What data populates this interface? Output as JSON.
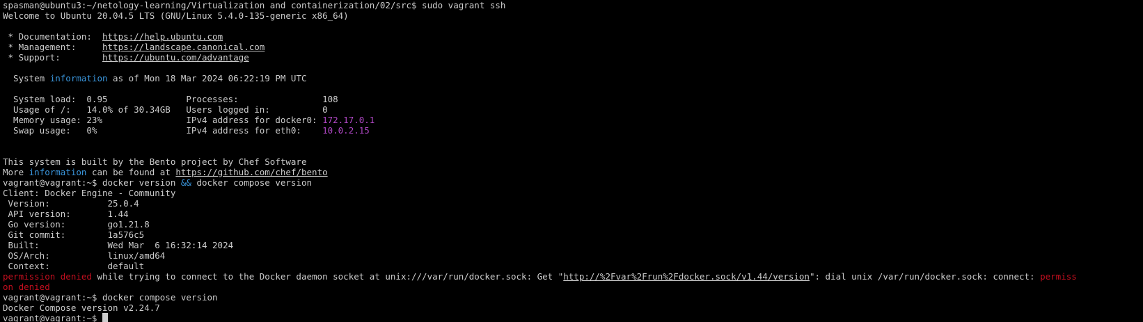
{
  "terminal": {
    "lines": [
      [
        {
          "t": "spasman@ubuntu3:~/netology-learning/Virtualization and containerization/02/src$ sudo vagrant ssh",
          "c": "white"
        }
      ],
      [
        {
          "t": "Welcome to Ubuntu 20.04.5 LTS (GNU/Linux 5.4.0-135-generic x86_64)",
          "c": "white"
        }
      ],
      [
        {
          "t": "",
          "c": "white"
        }
      ],
      [
        {
          "t": " * Documentation:  ",
          "c": "white"
        },
        {
          "t": "https://help.ubuntu.com",
          "c": "white",
          "u": true
        }
      ],
      [
        {
          "t": " * Management:     ",
          "c": "white"
        },
        {
          "t": "https://landscape.canonical.com",
          "c": "white",
          "u": true
        }
      ],
      [
        {
          "t": " * Support:        ",
          "c": "white"
        },
        {
          "t": "https://ubuntu.com/advantage",
          "c": "white",
          "u": true
        }
      ],
      [
        {
          "t": "",
          "c": "white"
        }
      ],
      [
        {
          "t": "  System ",
          "c": "white"
        },
        {
          "t": "information",
          "c": "cyan"
        },
        {
          "t": " as of Mon 18 Mar 2024 06:22:19 PM UTC",
          "c": "white"
        }
      ],
      [
        {
          "t": "",
          "c": "white"
        }
      ],
      [
        {
          "t": "  System load:  0.95               Processes:                108",
          "c": "white"
        }
      ],
      [
        {
          "t": "  Usage of /:   14.0% of 30.34GB   Users logged in:          0",
          "c": "white"
        }
      ],
      [
        {
          "t": "  Memory usage: 23%                IPv4 address for docker0: ",
          "c": "white"
        },
        {
          "t": "172.17.0.1",
          "c": "magenta"
        }
      ],
      [
        {
          "t": "  Swap usage:   0%                 IPv4 address for eth0:    ",
          "c": "white"
        },
        {
          "t": "10.0.2.15",
          "c": "magenta"
        }
      ],
      [
        {
          "t": "",
          "c": "white"
        }
      ],
      [
        {
          "t": "",
          "c": "white"
        }
      ],
      [
        {
          "t": "This system is built by the Bento project by Chef Software",
          "c": "white"
        }
      ],
      [
        {
          "t": "More ",
          "c": "white"
        },
        {
          "t": "information",
          "c": "cyan"
        },
        {
          "t": " can be found at ",
          "c": "white"
        },
        {
          "t": "https://github.com/chef/bento",
          "c": "white",
          "u": true
        }
      ],
      [
        {
          "t": "vagrant@vagrant:~$ docker version ",
          "c": "white"
        },
        {
          "t": "&&",
          "c": "cyan"
        },
        {
          "t": " docker compose version",
          "c": "white"
        }
      ],
      [
        {
          "t": "Client: Docker Engine - Community",
          "c": "white"
        }
      ],
      [
        {
          "t": " Version:           25.0.4",
          "c": "white"
        }
      ],
      [
        {
          "t": " API version:       1.44",
          "c": "white"
        }
      ],
      [
        {
          "t": " Go version:        go1.21.8",
          "c": "white"
        }
      ],
      [
        {
          "t": " Git commit:        1a576c5",
          "c": "white"
        }
      ],
      [
        {
          "t": " Built:             Wed Mar  6 16:32:14 2024",
          "c": "white"
        }
      ],
      [
        {
          "t": " OS/Arch:           linux/amd64",
          "c": "white"
        }
      ],
      [
        {
          "t": " Context:           default",
          "c": "white"
        }
      ],
      [
        {
          "t": "permission denied",
          "c": "red"
        },
        {
          "t": " while trying to connect to the Docker daemon socket at unix:///var/run/docker.sock: Get \"",
          "c": "white"
        },
        {
          "t": "http://%2Fvar%2Frun%2Fdocker.sock/v1.44/version",
          "c": "white",
          "u": true
        },
        {
          "t": "\": dial unix /var/run/docker.sock: connect: ",
          "c": "white"
        },
        {
          "t": "permiss",
          "c": "red"
        }
      ],
      [
        {
          "t": "on denied",
          "c": "red"
        }
      ],
      [
        {
          "t": "vagrant@vagrant:~$ docker compose version",
          "c": "white"
        }
      ],
      [
        {
          "t": "Docker Compose version v2.24.7",
          "c": "white"
        }
      ],
      [
        {
          "t": "vagrant@vagrant:~$ ",
          "c": "white"
        },
        {
          "cursor": true
        }
      ]
    ]
  },
  "colors": {
    "background": "#000000",
    "foreground": "#cccccc",
    "cyan": "#3a96dd",
    "magenta": "#b148c6",
    "red": "#c50f1f"
  }
}
